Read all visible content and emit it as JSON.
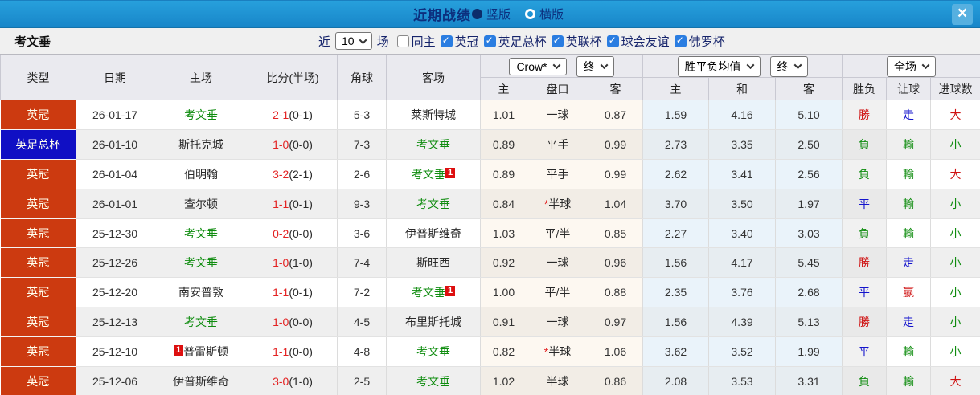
{
  "titlebar": {
    "title": "近期战绩",
    "radio_vertical": "竖版",
    "radio_horizontal": "横版",
    "close_label": "×"
  },
  "filterbar": {
    "team": "考文垂",
    "near_label": "近",
    "match_count": "10",
    "games_label": "场",
    "same_home_label": "同主",
    "leagues": [
      "英冠",
      "英足总杯",
      "英联杯",
      "球会友谊",
      "佛罗杯"
    ]
  },
  "table": {
    "static_headers": [
      "类型",
      "日期",
      "主场",
      "比分(半场)",
      "角球",
      "客场"
    ],
    "group_dropdowns": {
      "odds_company": "Crow*",
      "odds_time": "终",
      "avg_label": "胜平负均值",
      "avg_time": "终",
      "scope": "全场"
    },
    "sub_headers": [
      "主",
      "盘口",
      "客",
      "主",
      "和",
      "客",
      "胜负",
      "让球",
      "进球数"
    ],
    "rows": [
      {
        "league": "英冠",
        "league_color": "red",
        "date": "26-01-17",
        "home": "考文垂",
        "home_is_self": true,
        "home_redcards": "",
        "score": "2-1",
        "half": "(0-1)",
        "corners": "5-3",
        "away": "莱斯特城",
        "away_is_self": false,
        "away_redcards": "",
        "odds_home": "1.01",
        "handicap": "一球",
        "handicap_star": false,
        "odds_away": "0.87",
        "avg_home": "1.59",
        "avg_draw": "4.16",
        "avg_away": "5.10",
        "wdl": "勝",
        "wdl_color": "red",
        "let": "走",
        "let_color": "blue",
        "goals": "大",
        "goals_color": "red"
      },
      {
        "league": "英足总杯",
        "league_color": "blue",
        "date": "26-01-10",
        "home": "斯托克城",
        "home_is_self": false,
        "home_redcards": "",
        "score": "1-0",
        "half": "(0-0)",
        "corners": "7-3",
        "away": "考文垂",
        "away_is_self": true,
        "away_redcards": "",
        "odds_home": "0.89",
        "handicap": "平手",
        "handicap_star": false,
        "odds_away": "0.99",
        "avg_home": "2.73",
        "avg_draw": "3.35",
        "avg_away": "2.50",
        "wdl": "負",
        "wdl_color": "green",
        "let": "輸",
        "let_color": "green",
        "goals": "小",
        "goals_color": "green"
      },
      {
        "league": "英冠",
        "league_color": "red",
        "date": "26-01-04",
        "home": "伯明翰",
        "home_is_self": false,
        "home_redcards": "",
        "score": "3-2",
        "half": "(2-1)",
        "corners": "2-6",
        "away": "考文垂",
        "away_is_self": true,
        "away_redcards": "1",
        "odds_home": "0.89",
        "handicap": "平手",
        "handicap_star": false,
        "odds_away": "0.99",
        "avg_home": "2.62",
        "avg_draw": "3.41",
        "avg_away": "2.56",
        "wdl": "負",
        "wdl_color": "green",
        "let": "輸",
        "let_color": "green",
        "goals": "大",
        "goals_color": "red"
      },
      {
        "league": "英冠",
        "league_color": "red",
        "date": "26-01-01",
        "home": "查尔顿",
        "home_is_self": false,
        "home_redcards": "",
        "score": "1-1",
        "half": "(0-1)",
        "corners": "9-3",
        "away": "考文垂",
        "away_is_self": true,
        "away_redcards": "",
        "odds_home": "0.84",
        "handicap": "半球",
        "handicap_star": true,
        "odds_away": "1.04",
        "avg_home": "3.70",
        "avg_draw": "3.50",
        "avg_away": "1.97",
        "wdl": "平",
        "wdl_color": "blue",
        "let": "輸",
        "let_color": "green",
        "goals": "小",
        "goals_color": "green"
      },
      {
        "league": "英冠",
        "league_color": "red",
        "date": "25-12-30",
        "home": "考文垂",
        "home_is_self": true,
        "home_redcards": "",
        "score": "0-2",
        "half": "(0-0)",
        "corners": "3-6",
        "away": "伊普斯维奇",
        "away_is_self": false,
        "away_redcards": "",
        "odds_home": "1.03",
        "handicap": "平/半",
        "handicap_star": false,
        "odds_away": "0.85",
        "avg_home": "2.27",
        "avg_draw": "3.40",
        "avg_away": "3.03",
        "wdl": "負",
        "wdl_color": "green",
        "let": "輸",
        "let_color": "green",
        "goals": "小",
        "goals_color": "green"
      },
      {
        "league": "英冠",
        "league_color": "red",
        "date": "25-12-26",
        "home": "考文垂",
        "home_is_self": true,
        "home_redcards": "",
        "score": "1-0",
        "half": "(1-0)",
        "corners": "7-4",
        "away": "斯旺西",
        "away_is_self": false,
        "away_redcards": "",
        "odds_home": "0.92",
        "handicap": "一球",
        "handicap_star": false,
        "odds_away": "0.96",
        "avg_home": "1.56",
        "avg_draw": "4.17",
        "avg_away": "5.45",
        "wdl": "勝",
        "wdl_color": "red",
        "let": "走",
        "let_color": "blue",
        "goals": "小",
        "goals_color": "green"
      },
      {
        "league": "英冠",
        "league_color": "red",
        "date": "25-12-20",
        "home": "南安普敦",
        "home_is_self": false,
        "home_redcards": "",
        "score": "1-1",
        "half": "(0-1)",
        "corners": "7-2",
        "away": "考文垂",
        "away_is_self": true,
        "away_redcards": "1",
        "odds_home": "1.00",
        "handicap": "平/半",
        "handicap_star": false,
        "odds_away": "0.88",
        "avg_home": "2.35",
        "avg_draw": "3.76",
        "avg_away": "2.68",
        "wdl": "平",
        "wdl_color": "blue",
        "let": "赢",
        "let_color": "red",
        "goals": "小",
        "goals_color": "green"
      },
      {
        "league": "英冠",
        "league_color": "red",
        "date": "25-12-13",
        "home": "考文垂",
        "home_is_self": true,
        "home_redcards": "",
        "score": "1-0",
        "half": "(0-0)",
        "corners": "4-5",
        "away": "布里斯托城",
        "away_is_self": false,
        "away_redcards": "",
        "odds_home": "0.91",
        "handicap": "一球",
        "handicap_star": false,
        "odds_away": "0.97",
        "avg_home": "1.56",
        "avg_draw": "4.39",
        "avg_away": "5.13",
        "wdl": "勝",
        "wdl_color": "red",
        "let": "走",
        "let_color": "blue",
        "goals": "小",
        "goals_color": "green"
      },
      {
        "league": "英冠",
        "league_color": "red",
        "date": "25-12-10",
        "home": "普雷斯顿",
        "home_is_self": false,
        "home_redcards": "1",
        "score": "1-1",
        "half": "(0-0)",
        "corners": "4-8",
        "away": "考文垂",
        "away_is_self": true,
        "away_redcards": "",
        "odds_home": "0.82",
        "handicap": "半球",
        "handicap_star": true,
        "odds_away": "1.06",
        "avg_home": "3.62",
        "avg_draw": "3.52",
        "avg_away": "1.99",
        "wdl": "平",
        "wdl_color": "blue",
        "let": "輸",
        "let_color": "green",
        "goals": "小",
        "goals_color": "green"
      },
      {
        "league": "英冠",
        "league_color": "red",
        "date": "25-12-06",
        "home": "伊普斯维奇",
        "home_is_self": false,
        "home_redcards": "",
        "score": "3-0",
        "half": "(1-0)",
        "corners": "2-5",
        "away": "考文垂",
        "away_is_self": true,
        "away_redcards": "",
        "odds_home": "1.02",
        "handicap": "半球",
        "handicap_star": false,
        "odds_away": "0.86",
        "avg_home": "2.08",
        "avg_draw": "3.53",
        "avg_away": "3.31",
        "wdl": "負",
        "wdl_color": "green",
        "let": "輸",
        "let_color": "green",
        "goals": "大",
        "goals_color": "red"
      }
    ]
  },
  "colors": {
    "header_blue": "#1f90d2",
    "badge_red": "#cc3a10",
    "badge_blue": "#100fc4",
    "win_red": "#cf1212",
    "loss_green": "#0f8c0f",
    "draw_blue": "#1414cc",
    "self_team_green": "#0f8c0f",
    "checkbox_blue": "#2a7de1"
  }
}
